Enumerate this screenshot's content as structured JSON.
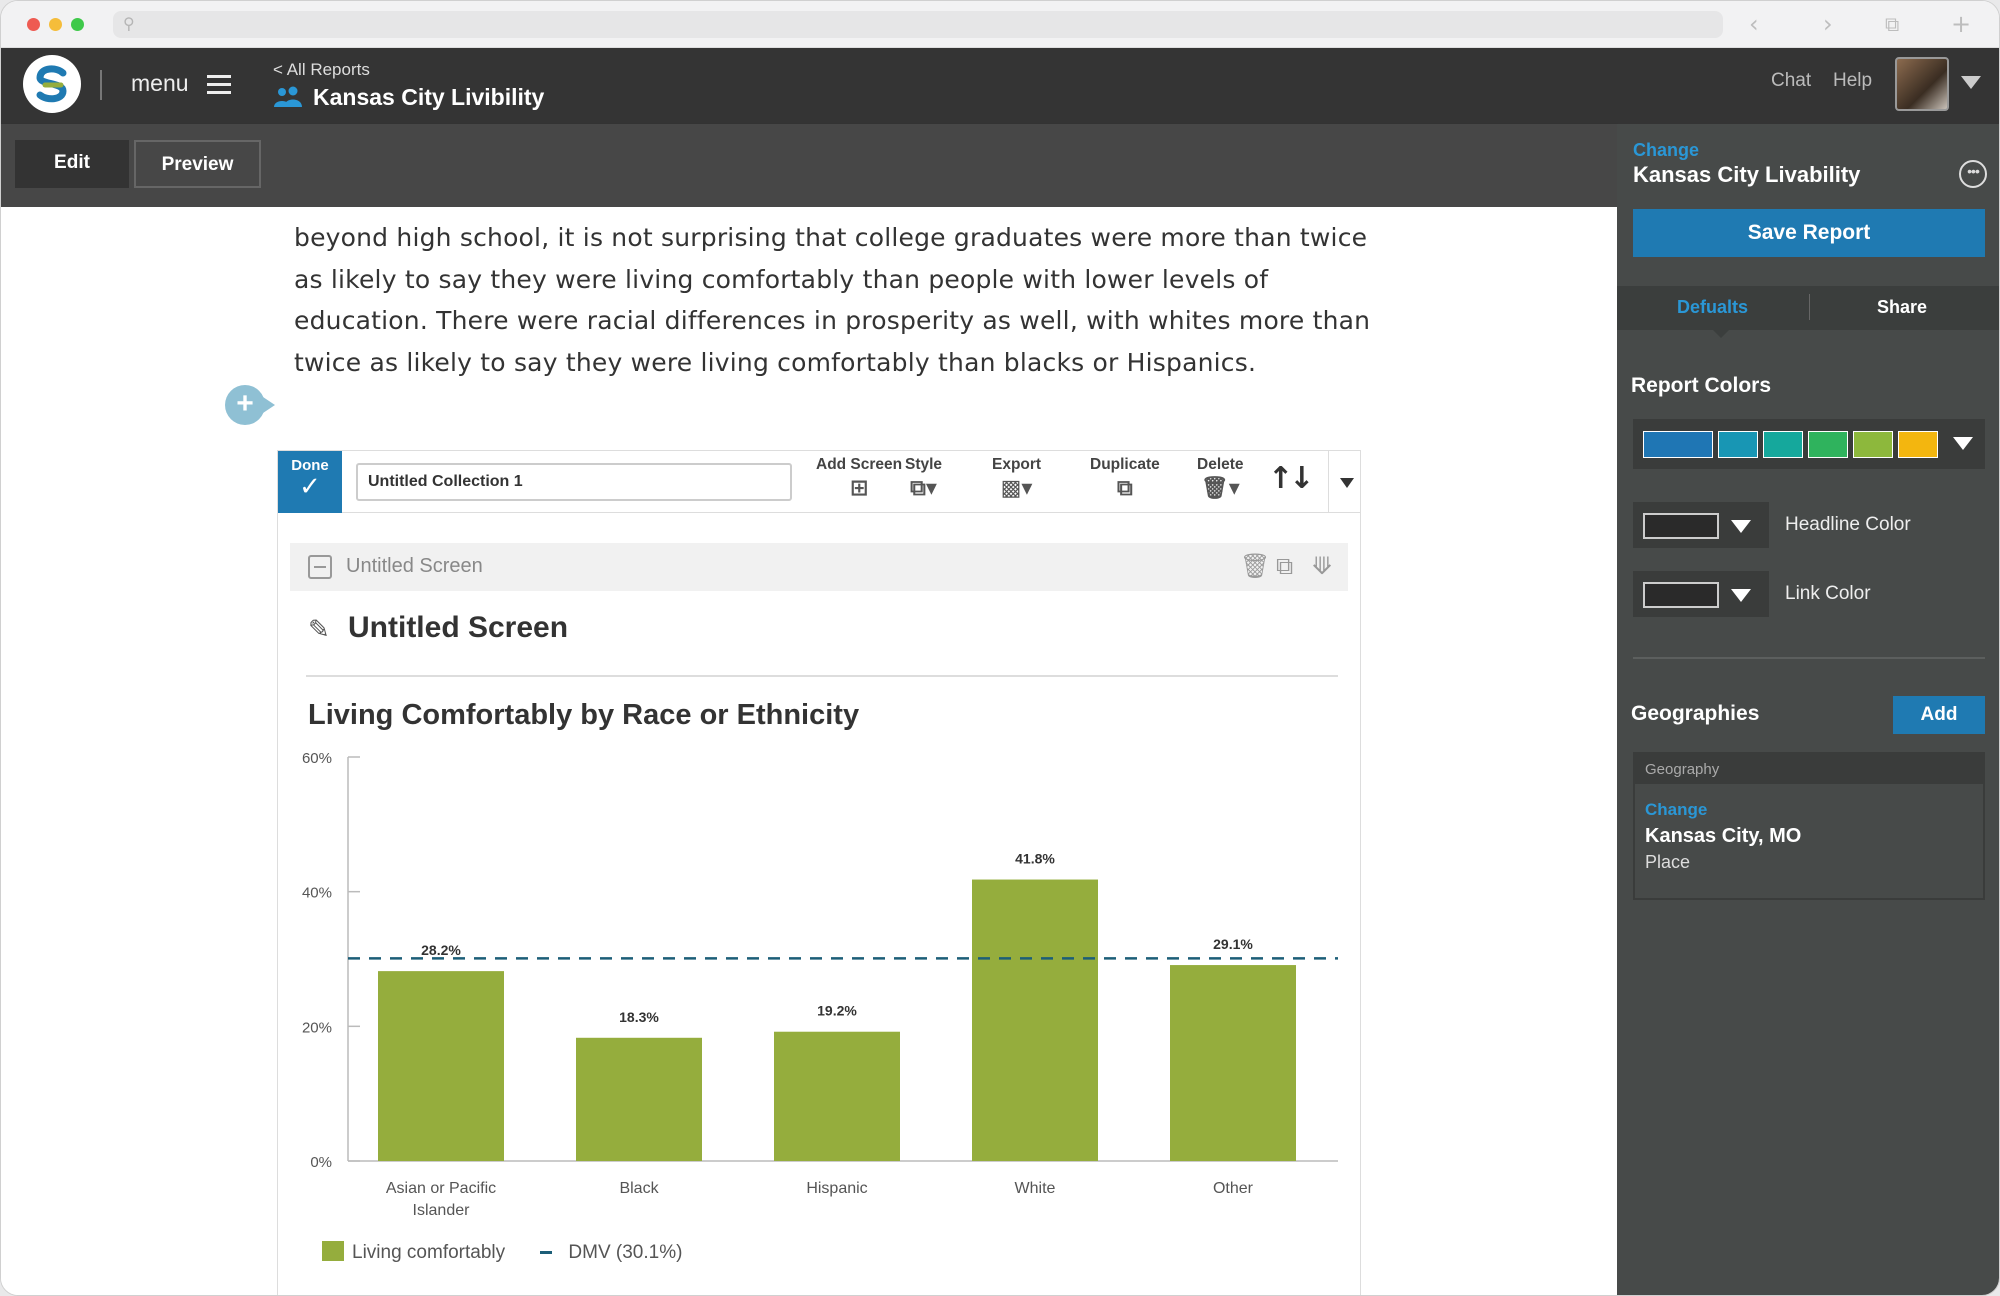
{
  "header": {
    "menu_label": "menu",
    "breadcrumb": "< All Reports",
    "report_title": "Kansas City Livibility",
    "chat_label": "Chat",
    "help_label": "Help"
  },
  "edit_bar": {
    "edit_label": "Edit",
    "preview_label": "Preview"
  },
  "content": {
    "paragraph": "beyond high school, it is not surprising that college graduates were more than twice as likely to say they were living comfortably than people with lower levels of education. There were racial differences in prosperity as well, with whites more than twice as likely to say they were living comfortably than blacks or Hispanics."
  },
  "collection": {
    "done_label": "Done",
    "name_value": "Untitled Collection 1",
    "tools": {
      "add_screen": "Add Screen",
      "style": "Style",
      "export": "Export",
      "duplicate": "Duplicate",
      "delete": "Delete"
    },
    "screen_bar_name": "Untitled Screen",
    "screen_title": "Untitled Screen"
  },
  "chart_data": {
    "type": "bar",
    "title": "Living Comfortably by Race or Ethnicity",
    "categories": [
      "Asian or Pacific Islander",
      "Black",
      "Hispanic",
      "White",
      "Other"
    ],
    "series": [
      {
        "name": "Living comfortably",
        "values": [
          28.2,
          18.3,
          19.2,
          41.8,
          29.1
        ]
      }
    ],
    "data_labels": [
      "28.2%",
      "18.3%",
      "19.2%",
      "41.8%",
      "29.1%"
    ],
    "reference_line": {
      "name": "DMV (30.1%)",
      "value": 30.1
    },
    "ylim": [
      0,
      60
    ],
    "y_ticks": [
      0,
      20,
      40,
      60
    ],
    "y_tick_labels": [
      "0%",
      "20%",
      "40%",
      "60%"
    ],
    "legend": {
      "placement": "bottom-left",
      "items": [
        "Living comfortably",
        "DMV (30.1%)"
      ]
    },
    "colors": {
      "bar": "#95ad3d",
      "reference": "#1c5e78"
    },
    "grid": false
  },
  "panel": {
    "change_label": "Change",
    "title": "Kansas City Livability",
    "save_label": "Save Report",
    "tab_defaults": "Defualts",
    "tab_share": "Share",
    "report_colors_title": "Report Colors",
    "report_colors": [
      "#1f76b4",
      "#1896b4",
      "#15a89c",
      "#2fb35d",
      "#8db83c",
      "#f3b60f"
    ],
    "headline_color_label": "Headline Color",
    "link_color_label": "Link Color",
    "geographies_title": "Geographies",
    "add_label": "Add",
    "geo_header": "Geography",
    "geo_change": "Change",
    "geo_name": "Kansas City, MO",
    "geo_type": "Place"
  }
}
